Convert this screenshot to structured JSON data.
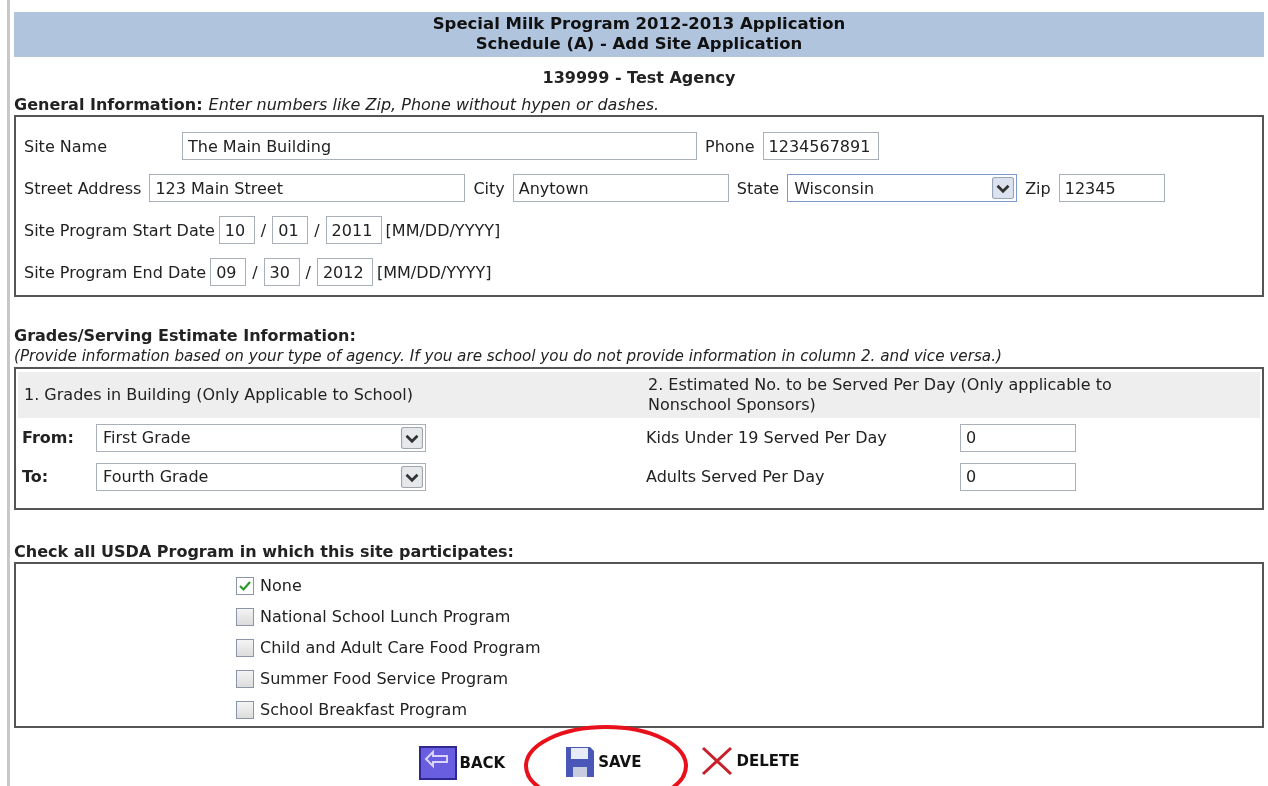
{
  "header": {
    "title": "Special Milk Program 2012-2013 Application",
    "subtitle": "Schedule (A) - Add Site Application"
  },
  "agency": "139999 - Test Agency",
  "general": {
    "heading": "General Information:",
    "note": "Enter numbers like Zip, Phone without hypen or dashes.",
    "site_name": {
      "label": "Site Name",
      "value": "The Main Building"
    },
    "phone": {
      "label": "Phone",
      "value": "1234567891"
    },
    "street": {
      "label": "Street Address",
      "value": "123 Main Street"
    },
    "city": {
      "label": "City",
      "value": "Anytown"
    },
    "state": {
      "label": "State",
      "value": "Wisconsin"
    },
    "zip": {
      "label": "Zip",
      "value": "12345"
    },
    "start_date": {
      "label": "Site Program Start Date",
      "month": "10",
      "day": "01",
      "year": "2011",
      "separator": "/",
      "format": "[MM/DD/YYYY]"
    },
    "end_date": {
      "label": "Site Program End Date",
      "month": "09",
      "day": "30",
      "year": "2012",
      "separator": "/",
      "format": "[MM/DD/YYYY]"
    }
  },
  "grades": {
    "heading": "Grades/Serving Estimate Information:",
    "note": "(Provide information based on your type of agency. If you are school you do not provide information in column 2. and vice versa.)",
    "column_1": "1. Grades in Building (Only Applicable to School)",
    "column_2": "2. Estimated No. to be Served Per Day (Only applicable to Nonschool Sponsors)",
    "from": {
      "label": "From:",
      "value": "First Grade"
    },
    "to": {
      "label": "To:",
      "value": "Fourth Grade"
    },
    "kids": {
      "label": "Kids Under 19 Served Per Day",
      "value": "0"
    },
    "adults": {
      "label": "Adults Served Per Day",
      "value": "0"
    }
  },
  "programs": {
    "heading": "Check all USDA Program in which this site participates:",
    "items": [
      {
        "label": "None",
        "checked": true
      },
      {
        "label": "National School Lunch Program",
        "checked": false
      },
      {
        "label": "Child and Adult Care Food Program",
        "checked": false
      },
      {
        "label": "Summer Food Service Program",
        "checked": false
      },
      {
        "label": "School Breakfast Program",
        "checked": false
      }
    ]
  },
  "buttons": [
    {
      "label": "BACK",
      "kind": "back",
      "circled": false
    },
    {
      "label": "SAVE",
      "kind": "save",
      "circled": true
    },
    {
      "label": "DELETE",
      "kind": "delete",
      "circled": false
    }
  ]
}
